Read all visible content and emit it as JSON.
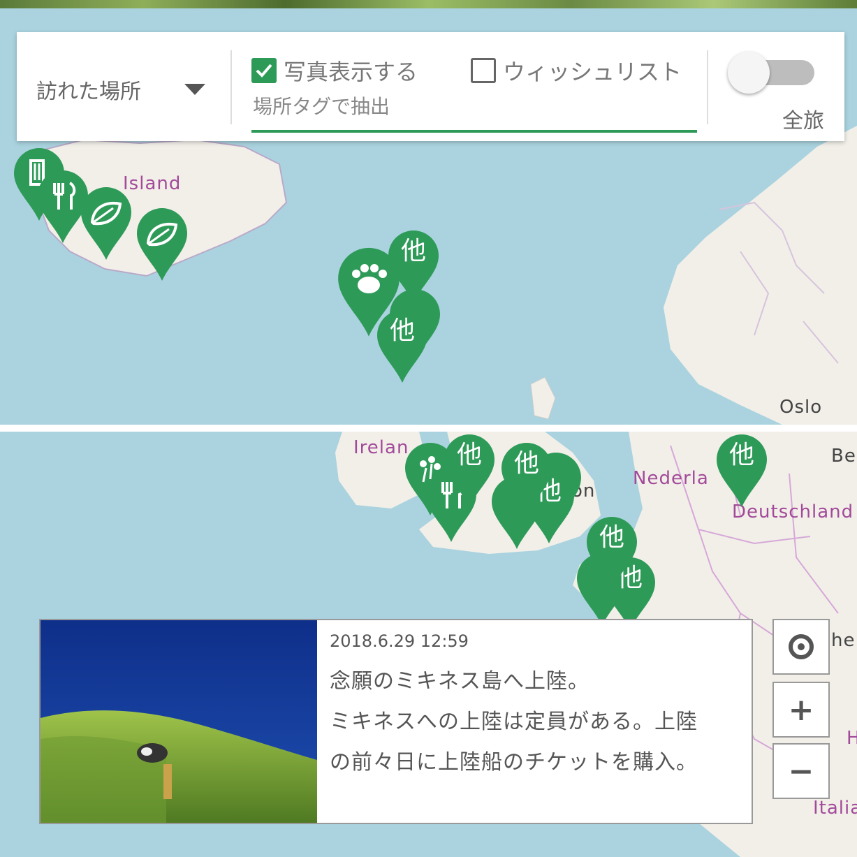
{
  "toolbar": {
    "dropdown_label": "訪れた場所",
    "show_photos": {
      "label": "写真表示する",
      "checked": true
    },
    "wishlist": {
      "label": "ウィッシュリスト",
      "checked": false
    },
    "tag_filter_placeholder": "場所タグで抽出",
    "all_trips": {
      "label": "全旅",
      "on": false
    }
  },
  "map_labels": {
    "island": "Island",
    "oslo": "Oslo",
    "ireland": "Irelan",
    "london_fragment": "on",
    "nederland": "Nederla",
    "deutschland": "Deutschland",
    "be": "Be",
    "he": "he",
    "italia": "Italia",
    "h": "H"
  },
  "pins": {
    "other_label": "他",
    "icon_names": [
      "building-icon",
      "restaurant-icon",
      "leaf-icon",
      "paw-icon",
      "flower-icon"
    ]
  },
  "popup": {
    "date": "2018.6.29 12:59",
    "lines": [
      "念願のミキネス島へ上陸。",
      "ミキネスへの上陸は定員がある。上陸",
      "の前々日に上陸船のチケットを購入。"
    ]
  },
  "controls": {
    "locate_icon": "locate-icon",
    "zoom_in": "+",
    "zoom_out": "−"
  },
  "colors": {
    "pin_green": "#2e9a58",
    "sea": "#aad3df",
    "land": "#f2efe9",
    "accent_green": "#2e9a58"
  }
}
